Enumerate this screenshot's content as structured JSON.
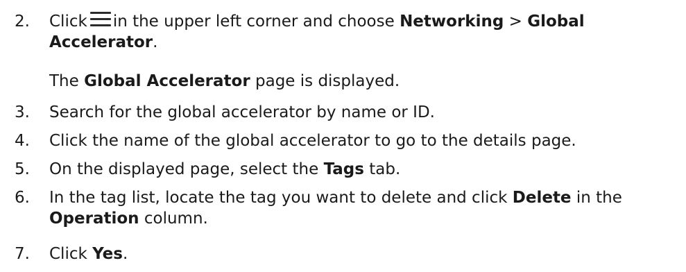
{
  "steps": [
    {
      "number": "2.",
      "text_before_icon": "Click",
      "icon": "hamburger-menu-icon",
      "text_after_icon": "in the upper left corner and choose",
      "bold_networking": "Networking",
      "separator": ">",
      "bold_global": "Global",
      "bold_accelerator": "Accelerator",
      "period": ".",
      "result_bold": "Global Accelerator",
      "result_before": "The",
      "result_after": "page is displayed."
    },
    {
      "number": "3.",
      "text": "Search for the global accelerator by name or ID."
    },
    {
      "number": "4.",
      "text": "Click the name of the global accelerator to go to the details page."
    },
    {
      "number": "5.",
      "text_before": "On the displayed page, select the",
      "bold": "Tags",
      "text_after": "tab."
    },
    {
      "number": "6.",
      "text_before": "In the tag list, locate the tag you want to delete and click",
      "bold_delete": "Delete",
      "text_middle": "in the",
      "bold_operation": "Operation",
      "text_after": "column."
    },
    {
      "number": "7.",
      "text_before": "Click",
      "bold": "Yes",
      "period": "."
    }
  ]
}
